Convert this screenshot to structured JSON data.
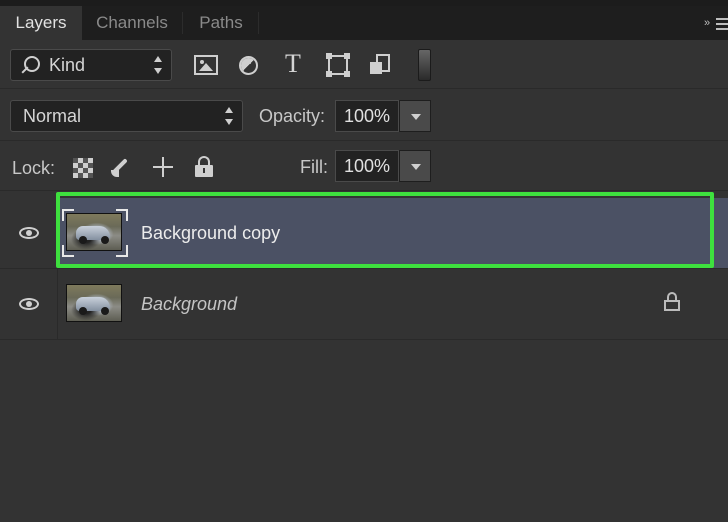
{
  "tabs": [
    {
      "label": "Layers",
      "active": true
    },
    {
      "label": "Channels",
      "active": false
    },
    {
      "label": "Paths",
      "active": false
    }
  ],
  "filter": {
    "kind_label": "Kind",
    "icons": [
      "image-filter-icon",
      "adjustment-filter-icon",
      "type-filter-icon",
      "shape-filter-icon",
      "smart-object-filter-icon"
    ],
    "type_glyph": "T"
  },
  "blend": {
    "mode": "Normal",
    "opacity_label": "Opacity:",
    "opacity_value": "100%"
  },
  "lock": {
    "label": "Lock:",
    "fill_label": "Fill:",
    "fill_value": "100%"
  },
  "layers": [
    {
      "name": "Background copy",
      "selected": true,
      "visible": true,
      "locked": false
    },
    {
      "name": "Background",
      "selected": false,
      "visible": true,
      "locked": true
    }
  ],
  "colors": {
    "panel_bg": "#333333",
    "selected_layer_bg": "#4b5164",
    "highlight_outline": "#3ee03e"
  }
}
